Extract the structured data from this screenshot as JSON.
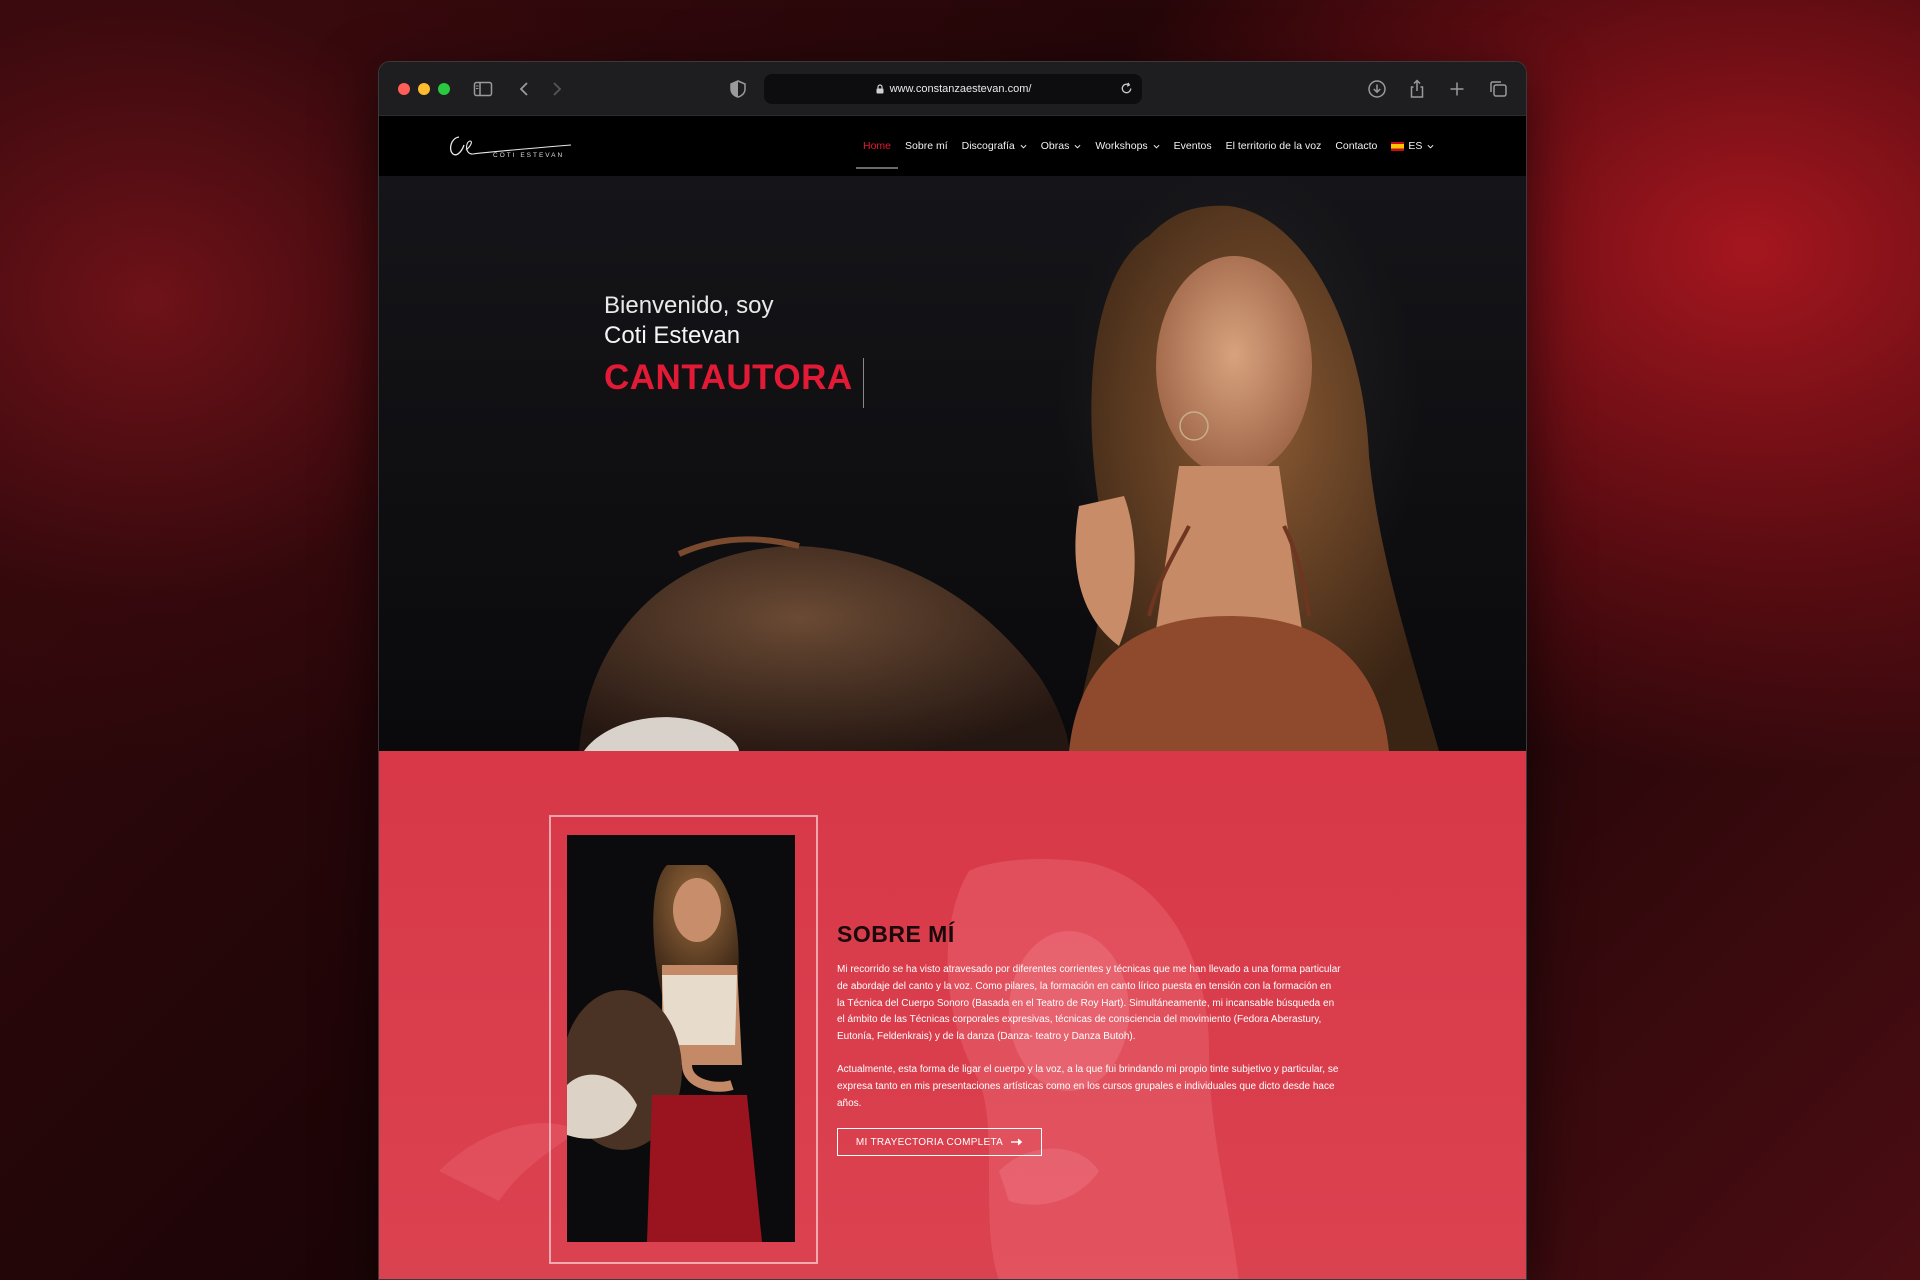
{
  "browser": {
    "url": "www.constanzaestevan.com/"
  },
  "nav": {
    "logo_text": "COTI ESTEVAN",
    "items": [
      {
        "label": "Home",
        "dropdown": false,
        "active": true
      },
      {
        "label": "Sobre mí",
        "dropdown": false,
        "active": false
      },
      {
        "label": "Discografía",
        "dropdown": true,
        "active": false
      },
      {
        "label": "Obras",
        "dropdown": true,
        "active": false
      },
      {
        "label": "Workshops",
        "dropdown": true,
        "active": false
      },
      {
        "label": "Eventos",
        "dropdown": false,
        "active": false
      },
      {
        "label": "El territorio de la voz",
        "dropdown": false,
        "active": false
      },
      {
        "label": "Contacto",
        "dropdown": false,
        "active": false
      }
    ],
    "language": "ES"
  },
  "hero": {
    "greeting": "Bienvenido, soy",
    "name": "Coti Estevan",
    "role": "CANTAUTORA"
  },
  "about": {
    "title": "SOBRE MÍ",
    "paragraph1": "Mi recorrido se ha visto atravesado por diferentes corrientes y técnicas que me han llevado a una forma particular de abordaje del canto y la voz. Como pilares, la formación en canto lírico puesta en tensión con la formación en la Técnica del Cuerpo Sonoro (Basada en el Teatro de Roy Hart). Simultáneamente, mi incansable búsqueda en el ámbito de las Técnicas corporales expresivas, técnicas de consciencia del movimiento (Fedora Aberastury, Eutonía, Feldenkrais) y de la danza (Danza- teatro y Danza Butoh).",
    "paragraph2": "Actualmente, esta forma de ligar el cuerpo y la voz, a la que fui brindando mi propio tinte subjetivo y particular, se expresa tanto en mis presentaciones artísticas como en los cursos grupales e individuales que dicto desde hace años.",
    "button_label": "MI TRAYECTORIA COMPLETA"
  },
  "colors": {
    "accent": "#e21a35",
    "about_bg": "#d83848",
    "nav_bg": "#000000"
  }
}
